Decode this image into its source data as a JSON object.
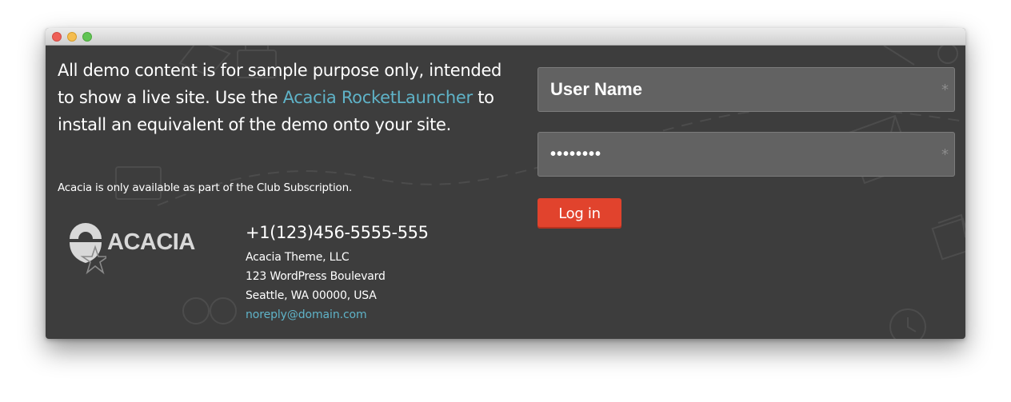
{
  "intro": {
    "text_before": "All demo content is for sample purpose only, intended to show a live site. Use the ",
    "link_text": "Acacia RocketLauncher",
    "text_after": " to install an equivalent of the demo onto your site."
  },
  "note": "Acacia is only available as part of the Club Subscription.",
  "logo": {
    "text": "ACACIA"
  },
  "contact": {
    "phone": "+1(123)456-5555-555",
    "company": "Acacia Theme, LLC",
    "street": "123 WordPress Boulevard",
    "city": "Seattle, WA 00000, USA",
    "email": "noreply@domain.com"
  },
  "login_form": {
    "username_placeholder": "User Name",
    "password_value": "password",
    "required_mark": "*",
    "submit_label": "Log in"
  },
  "colors": {
    "background": "#3d3d3d",
    "link": "#5fb3c8",
    "button": "#e1432d",
    "field": "#626262"
  }
}
